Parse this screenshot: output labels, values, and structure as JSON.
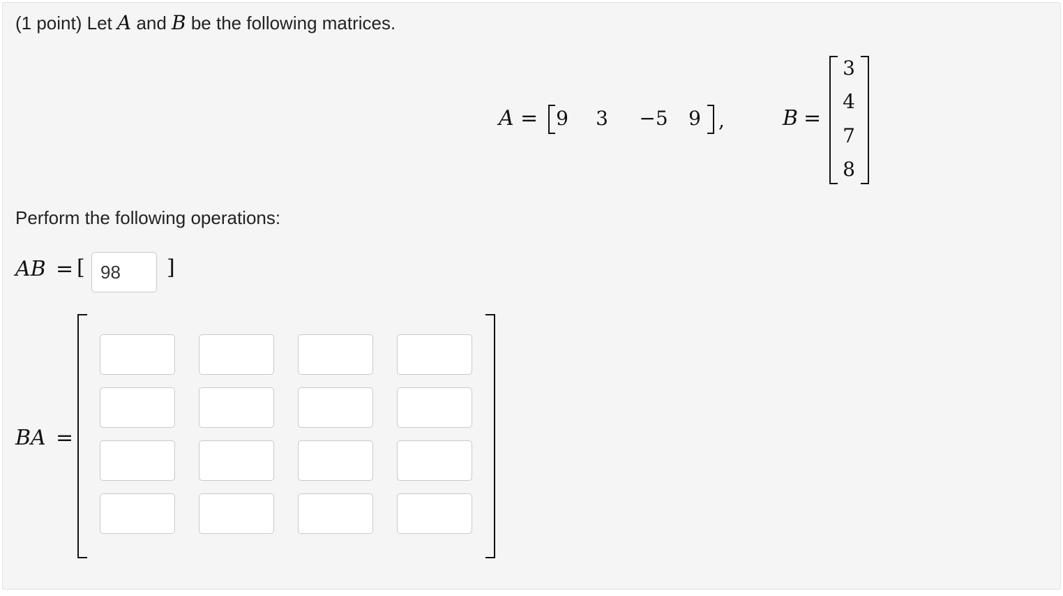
{
  "problem": {
    "intro_prefix": "(1 point) Let ",
    "var_a": "A",
    "and_text": " and ",
    "var_b": "B",
    "intro_suffix": " be the following matrices.",
    "matrix_a_label": "A",
    "matrix_a_values": [
      "9",
      "3",
      "−5",
      "9"
    ],
    "matrix_b_label": "B",
    "matrix_b_values": [
      "3",
      "4",
      "7",
      "8"
    ],
    "equals": "=",
    "comma": ",",
    "instructions": "Perform the following operations:"
  },
  "ab": {
    "label": "AB",
    "open_bracket": "[",
    "close_bracket": "]",
    "value": "98"
  },
  "ba": {
    "label": "BA",
    "cells": [
      [
        "",
        "",
        "",
        ""
      ],
      [
        "",
        "",
        "",
        ""
      ],
      [
        "",
        "",
        "",
        ""
      ],
      [
        "",
        "",
        "",
        ""
      ]
    ]
  }
}
